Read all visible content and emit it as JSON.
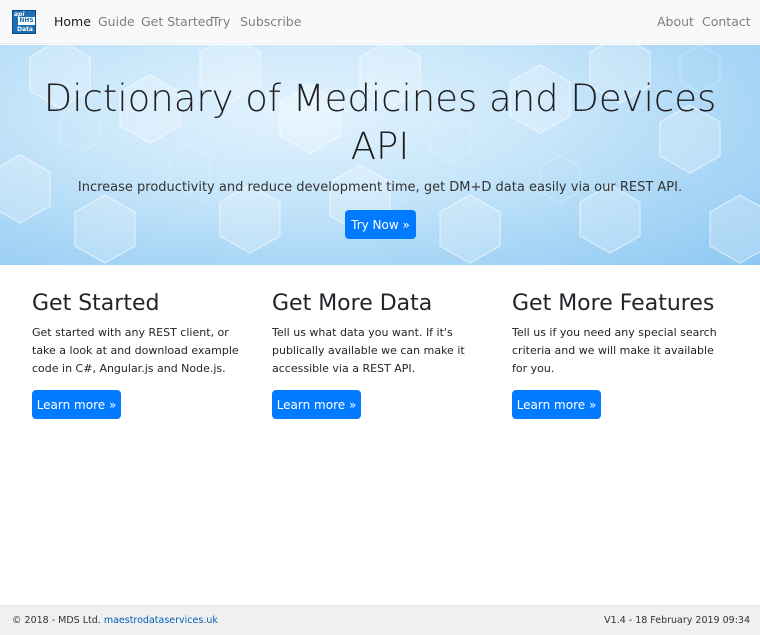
{
  "navbar": {
    "brand": {
      "line1": "api",
      "line2": "NHS",
      "line3": "Data"
    },
    "left_links": [
      {
        "label": "Home",
        "active": true
      },
      {
        "label": "Guide",
        "active": false
      },
      {
        "label": "Get Started",
        "active": false
      },
      {
        "label": "Try",
        "active": false
      },
      {
        "label": "Subscribe",
        "active": false
      }
    ],
    "right_links": [
      {
        "label": "About"
      },
      {
        "label": "Contact"
      }
    ]
  },
  "hero": {
    "title_line1": "Dictionary of Medicines and Devices",
    "title_line2": "API",
    "lead": "Increase productivity and reduce development time, get DM+D data easily via our REST API.",
    "button": "Try Now »"
  },
  "columns": [
    {
      "heading": "Get Started",
      "text": "Get started with any REST client, or take a look at and download example code in C#, Angular.js and Node.js.",
      "button": "Learn more »"
    },
    {
      "heading": "Get More Data",
      "text": "Tell us what data you want. If it's publically available we can make it accessible via a REST API.",
      "button": "Learn more »"
    },
    {
      "heading": "Get More Features",
      "text": "Tell us if you need any special search criteria and we will make it available for you.",
      "button": "Learn more »"
    }
  ],
  "footer": {
    "copyright": "© 2018 - MDS Ltd.",
    "link": "maestrodataservices.uk",
    "version": "V1.4 - 18 February 2019 09:34"
  },
  "colors": {
    "primary": "#007bff",
    "navbar_bg": "#f8f9fa",
    "footer_bg": "#f0f0f0",
    "footer_link": "#0061b8"
  }
}
